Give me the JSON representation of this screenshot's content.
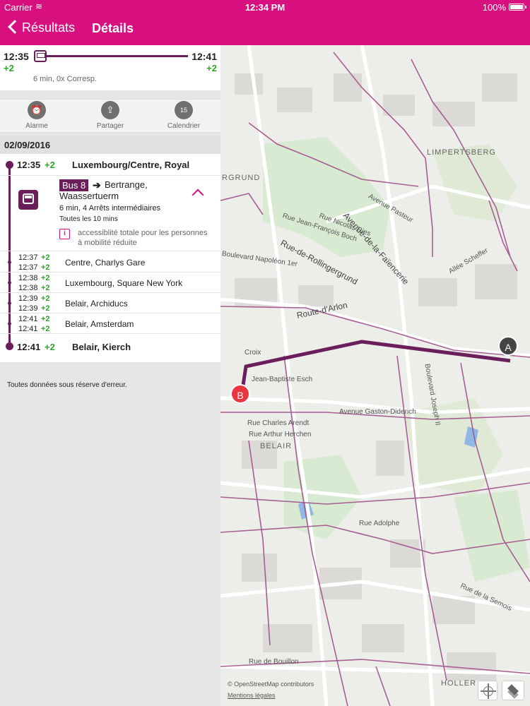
{
  "status_bar": {
    "carrier": "Carrier",
    "time": "12:34 PM",
    "battery": "100%"
  },
  "nav": {
    "back_label": "Résultats",
    "title": "Détails"
  },
  "summary": {
    "departure_time": "12:35",
    "departure_delay": "+2",
    "arrival_time": "12:41",
    "arrival_delay": "+2",
    "info": "6 min, 0x Corresp."
  },
  "actions": [
    {
      "label": "Alarme",
      "icon": "alarm-clock-icon",
      "glyph": "⏰"
    },
    {
      "label": "Partager",
      "icon": "share-icon",
      "glyph": "⇪"
    },
    {
      "label": "Calendrier",
      "icon": "calendar-icon",
      "glyph": "15"
    }
  ],
  "date": "02/09/2016",
  "journey": {
    "start": {
      "time": "12:35",
      "delay": "+2",
      "stop": "Luxembourg/Centre, Royal"
    },
    "bus": {
      "line": "Bus 8",
      "arrow": "➔",
      "destination": "Bertrange, Waassertuerm",
      "info": "6 min, 4 Arrêts intermédiaires",
      "frequency": "Toutes les 10 mins",
      "info_icon": "i",
      "accessibility": "accessiblité totale pour les personnes à mobilité réduite"
    },
    "intermediate": [
      {
        "t1": "12:37",
        "d1": "+2",
        "t2": "12:37",
        "d2": "+2",
        "stop": "Centre, Charlys Gare"
      },
      {
        "t1": "12:38",
        "d1": "+2",
        "t2": "12:38",
        "d2": "+2",
        "stop": "Luxembourg, Square New York"
      },
      {
        "t1": "12:39",
        "d1": "+2",
        "t2": "12:39",
        "d2": "+2",
        "stop": "Belair, Archiducs"
      },
      {
        "t1": "12:41",
        "d1": "+2",
        "t2": "12:41",
        "d2": "+2",
        "stop": "Belair, Amsterdam"
      }
    ],
    "end": {
      "time": "12:41",
      "delay": "+2",
      "stop": "Belair, Kierch"
    }
  },
  "disclaimer": "Toutes données sous réserve d'erreur.",
  "map": {
    "labels": {
      "limpertsberg": "LIMPERTSBERG",
      "grund": "RGRUND",
      "belair": "BELAIR",
      "holler": "HOLLER",
      "faiencerie": "Avenue-de-la-Faïencerie",
      "rollingergrund": "Rue-de-Rollingergrund",
      "arlon": "Route-d'Arlon",
      "pasteur": "Avenue Pasteur",
      "boch": "Rue Jean-François Boch",
      "nicolas_ries": "Rue Nicolas Ries",
      "napoleon": "Boulevard Napoléon 1er",
      "gaston": "Avenue Gaston-Diderich",
      "arendt": "Rue Charles Arendt",
      "herchen": "Rue Arthur Herchen",
      "esch": "Jean-Baptiste Esch",
      "adolphe": "Rue Adolphe",
      "bouillon": "Rue de Bouillon",
      "scheffer": "Allée Scheffer",
      "joseph": "Boulevard Joseph II",
      "semois": "Rue de la Semois",
      "croix": "Croix"
    },
    "marker_a": "A",
    "marker_b": "B",
    "attribution": "© OpenStreetMap contributors",
    "legal": "Mentions légales",
    "route_color": "#6b1f5a",
    "accent_color": "#d8107f"
  }
}
